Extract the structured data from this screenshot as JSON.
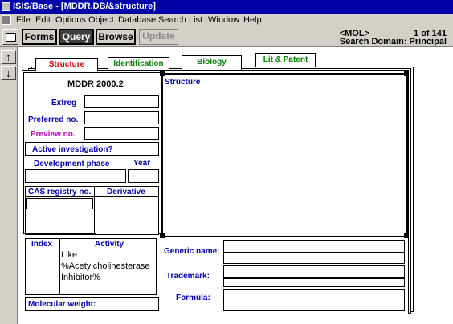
{
  "window": {
    "title": "ISIS/Base - [MDDR.DB/&structure]"
  },
  "menu": [
    "File",
    "Edit",
    "Options",
    "Object",
    "Database",
    "Search",
    "List",
    "Window",
    "Help"
  ],
  "toolbar": {
    "forms": "Forms",
    "query": "Query",
    "browse": "Browse",
    "update": "Update",
    "mol_tag": "<MOL>",
    "record_counter": "1  of 141",
    "search_domain": "Search Domain:  Principal"
  },
  "tabs": {
    "structure": "Structure",
    "identification": "Identification",
    "biology": "Biology",
    "lit_patent": "Lit & Patent"
  },
  "form": {
    "db_title": "MDDR 2000.2",
    "extreg": "Extreg",
    "preferred_no": "Preferred no.",
    "preview_no": "Preview no.",
    "active_investigation": "Active investigation?",
    "development_phase": "Development phase",
    "year": "Year",
    "cas_registry_no": "CAS registry no.",
    "derivative": "Derivative",
    "structure": "Structure",
    "index": "Index",
    "activity": "Activity",
    "activity_query": "Like %Acetylcholinesterase Inhibitor%",
    "molecular_weight": "Molecular weight:",
    "generic_name": "Generic name:",
    "trademark": "Trademark:",
    "formula": "Formula:"
  },
  "colors": {
    "titlebar": "#0000a8",
    "label_blue": "#0000a8",
    "tab_red": "#d00000",
    "tab_green": "#008000",
    "preview_magenta": "#c000c0"
  }
}
